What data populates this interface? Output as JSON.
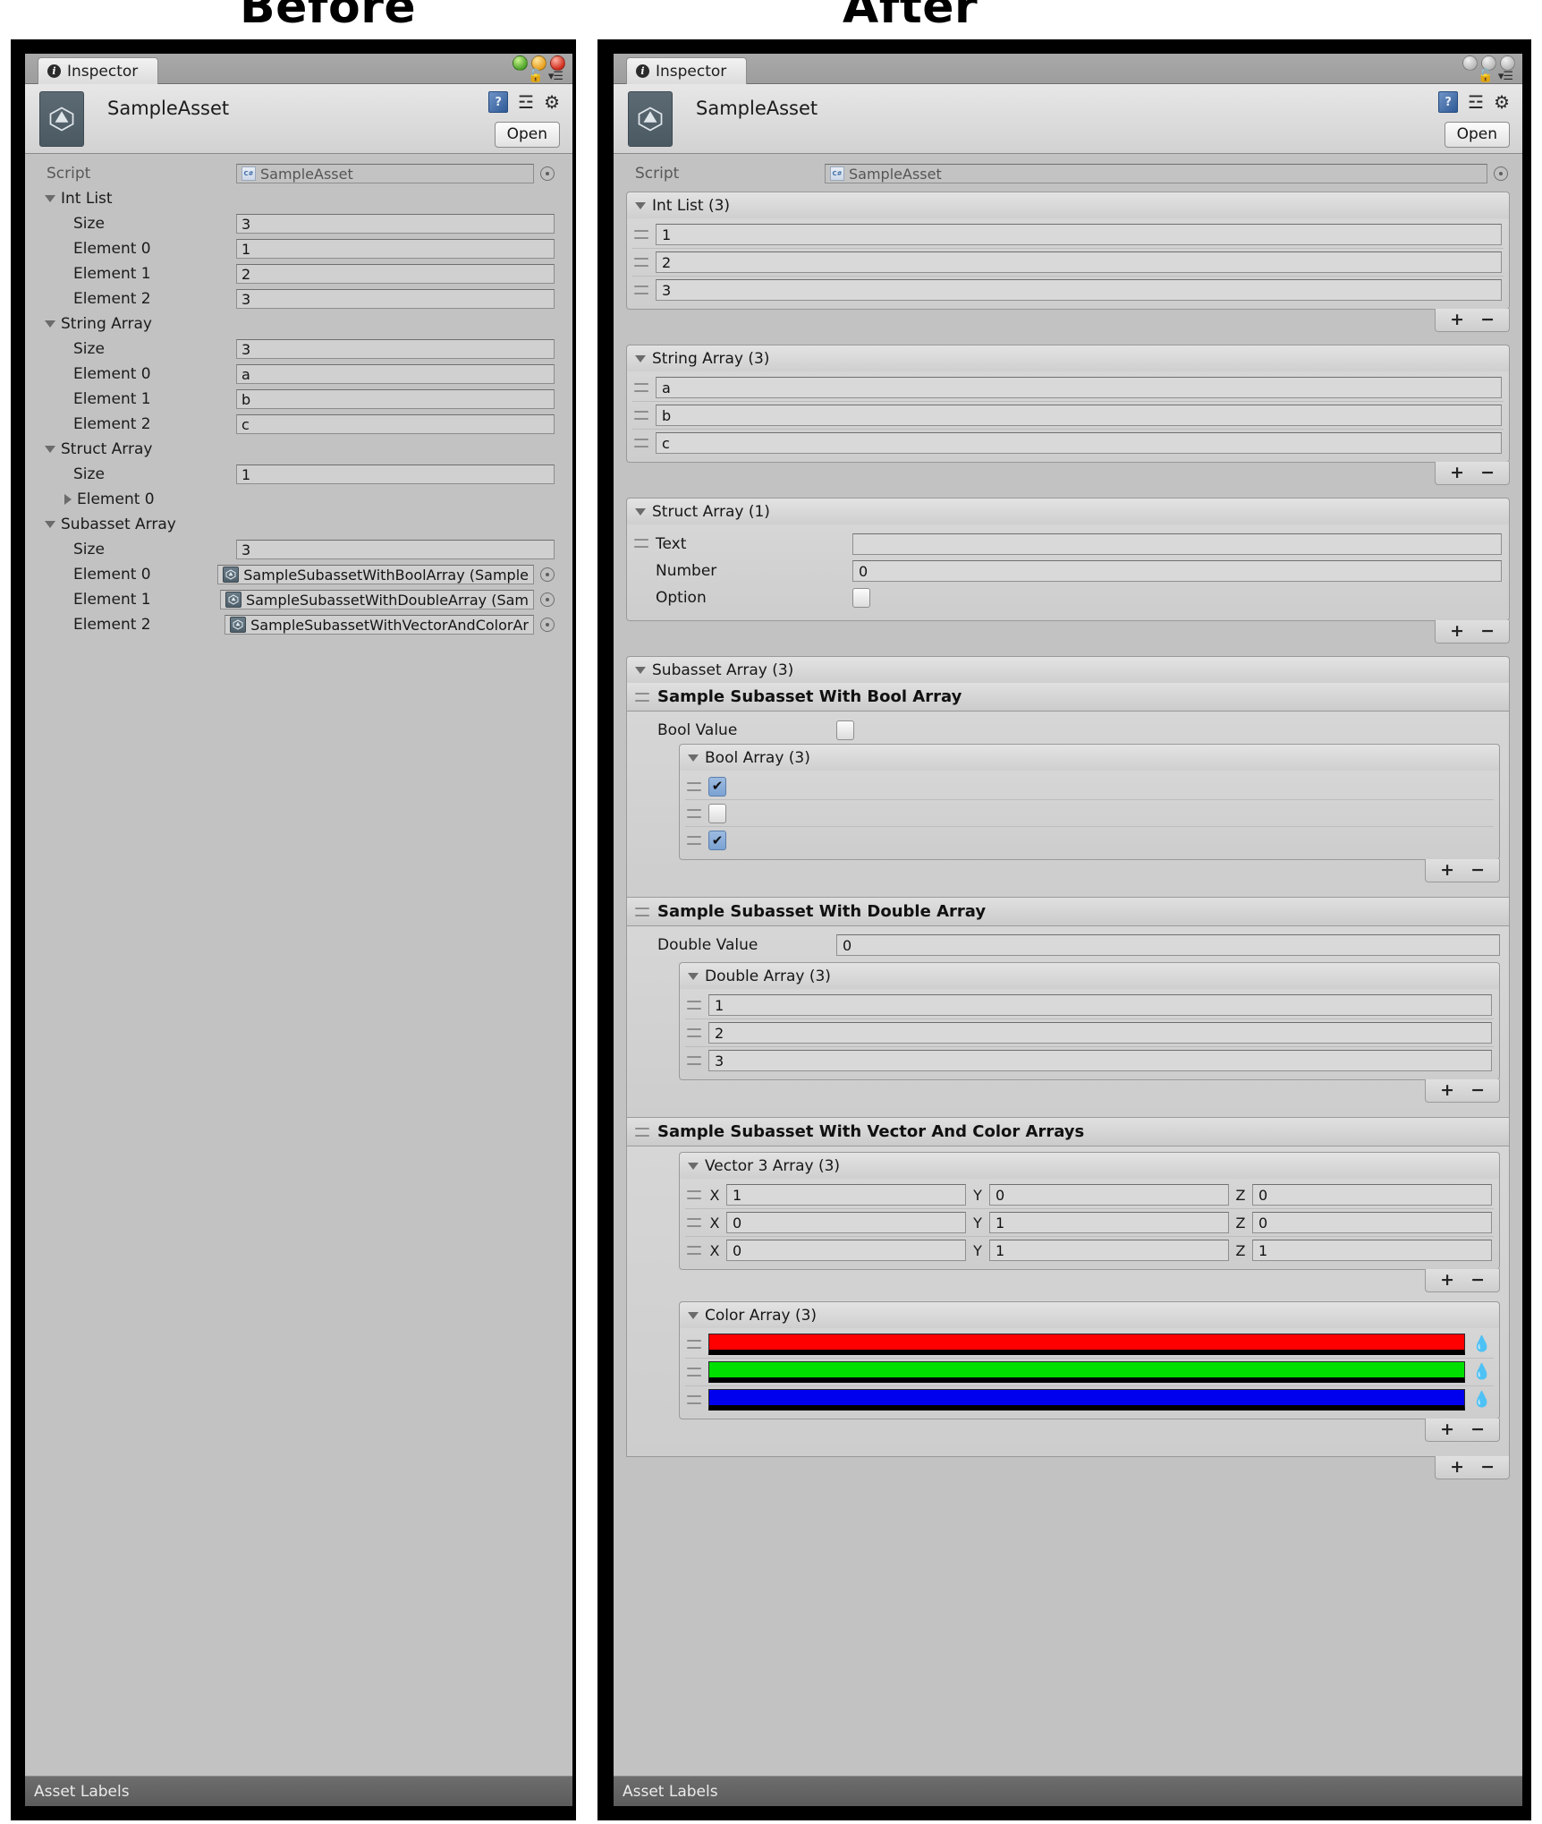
{
  "captions": {
    "before": "Before",
    "after": "After"
  },
  "window": {
    "tab_label": "Inspector",
    "asset_title": "SampleAsset",
    "open_button": "Open",
    "footer_label": "Asset Labels",
    "icons": {
      "info": "i",
      "lock": "🔓",
      "menu": "▾☰",
      "help": "?",
      "preset": "☲",
      "gear": "⚙"
    },
    "traffic_lights": [
      "green",
      "yellow",
      "red"
    ]
  },
  "script_row": {
    "label": "Script",
    "value": "SampleAsset",
    "chip": "C#"
  },
  "before": {
    "sections": [
      {
        "name": "Int List",
        "foldout": "open",
        "rows": [
          {
            "label": "Size",
            "value": "3"
          },
          {
            "label": "Element 0",
            "value": "1"
          },
          {
            "label": "Element 1",
            "value": "2"
          },
          {
            "label": "Element 2",
            "value": "3"
          }
        ]
      },
      {
        "name": "String Array",
        "foldout": "open",
        "rows": [
          {
            "label": "Size",
            "value": "3"
          },
          {
            "label": "Element 0",
            "value": "a"
          },
          {
            "label": "Element 1",
            "value": "b"
          },
          {
            "label": "Element 2",
            "value": "c"
          }
        ]
      },
      {
        "name": "Struct Array",
        "foldout": "open",
        "rows": [
          {
            "label": "Size",
            "value": "1"
          },
          {
            "label": "Element 0",
            "value": "",
            "collapsed": true
          }
        ]
      },
      {
        "name": "Subasset Array",
        "foldout": "open",
        "rows": [
          {
            "label": "Size",
            "value": "3"
          },
          {
            "label": "Element 0",
            "value": "SampleSubassetWithBoolArray (Sample",
            "object": true
          },
          {
            "label": "Element 1",
            "value": "SampleSubassetWithDoubleArray (Sam",
            "object": true
          },
          {
            "label": "Element 2",
            "value": "SampleSubassetWithVectorAndColorAr",
            "object": true
          }
        ]
      }
    ]
  },
  "after": {
    "int_list": {
      "header": "Int List (3)",
      "items": [
        "1",
        "2",
        "3"
      ]
    },
    "string_array": {
      "header": "String Array (3)",
      "items": [
        "a",
        "b",
        "c"
      ]
    },
    "struct_array": {
      "header": "Struct Array (1)",
      "fields": [
        {
          "label": "Text",
          "value": "",
          "type": "text"
        },
        {
          "label": "Number",
          "value": "0",
          "type": "text"
        },
        {
          "label": "Option",
          "value": false,
          "type": "bool"
        }
      ]
    },
    "subasset_array": {
      "header": "Subasset Array (3)",
      "items": [
        {
          "title": "Sample Subasset With Bool Array",
          "value_field": {
            "label": "Bool Value",
            "value": false,
            "type": "bool"
          },
          "list": {
            "header": "Bool Array (3)",
            "type": "bool",
            "items": [
              true,
              false,
              true
            ]
          }
        },
        {
          "title": "Sample Subasset With Double Array",
          "value_field": {
            "label": "Double Value",
            "value": "0",
            "type": "text"
          },
          "list": {
            "header": "Double Array (3)",
            "type": "text",
            "items": [
              "1",
              "2",
              "3"
            ]
          }
        },
        {
          "title": "Sample Subasset With Vector And Color Arrays",
          "vector_list": {
            "header": "Vector 3 Array (3)",
            "axis_labels": [
              "X",
              "Y",
              "Z"
            ],
            "items": [
              [
                "1",
                "0",
                "0"
              ],
              [
                "0",
                "1",
                "0"
              ],
              [
                "0",
                "1",
                "1"
              ]
            ]
          },
          "color_list": {
            "header": "Color Array (3)",
            "items": [
              "#ff0000",
              "#00e000",
              "#0000ee"
            ]
          }
        }
      ]
    },
    "footer_buttons": {
      "add": "+",
      "remove": "−"
    }
  }
}
